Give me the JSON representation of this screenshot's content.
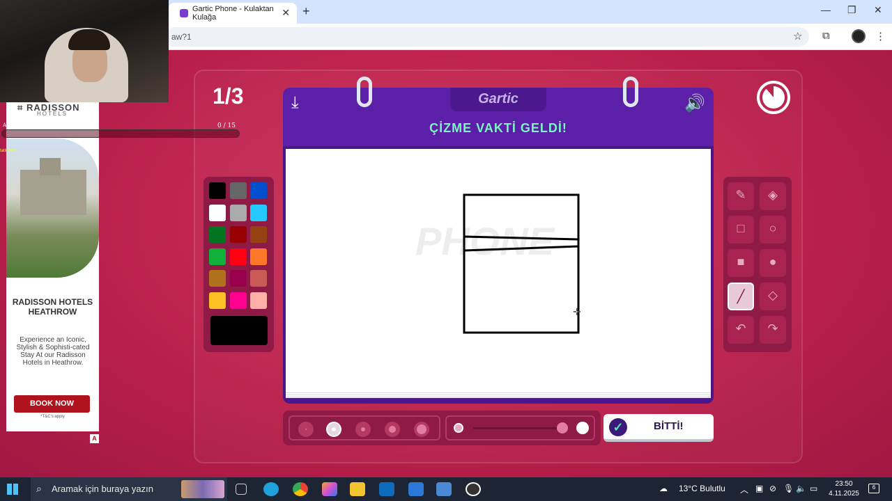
{
  "browser": {
    "tab_title": "Gartic Phone - Kulaktan Kulağa",
    "new_tab": "+",
    "close_tab": "✕",
    "url_fragment": "aw?1",
    "window_controls": [
      "—",
      "❐",
      "✕"
    ],
    "icons": [
      "star-icon",
      "extensions-icon",
      "profile-icon",
      "menu-icon"
    ]
  },
  "game": {
    "round": "1/3",
    "progress": "0 / 15",
    "logo": "Gartic",
    "instruction": "ÇİZME VAKTİ GELDİ!",
    "watermark": "PHONE",
    "done_label": "BİTTİ!",
    "palette": [
      "#000000",
      "#666666",
      "#0050cd",
      "#ffffff",
      "#aaaaaa",
      "#26c9ff",
      "#017420",
      "#990000",
      "#964112",
      "#11b03c",
      "#ff0013",
      "#ff7829",
      "#b0701c",
      "#99004e",
      "#cb5a57",
      "#ffc126",
      "#ff008f",
      "#feafa8"
    ],
    "selected_color": "#000000",
    "tools": [
      "pencil-icon",
      "eraser-icon",
      "rectangle-outline-icon",
      "ellipse-outline-icon",
      "rectangle-filled-icon",
      "ellipse-filled-icon",
      "line-icon",
      "fill-bucket-icon",
      "undo-icon",
      "redo-icon"
    ],
    "active_tool": "line-icon",
    "brush_sizes": 5,
    "selected_size_index": 1,
    "opacity_level": 0.9
  },
  "overlay": {
    "bar_text": "AYLIK ABONE HEDEFİ",
    "chat_user": "tatlıcadır"
  },
  "ad": {
    "brand": "RADISSON",
    "brand_sub": "HOTELS",
    "title": "RADISSON HOTELS HEATHROW",
    "text": "Experience an Iconic, Stylish & Sophisti-cated Stay At our Radisson Hotels in Heathrow.",
    "cta": "BOOK NOW",
    "terms": "*T&C's apply",
    "adchoices": "A"
  },
  "taskbar": {
    "search_placeholder": "Aramak için buraya yazın",
    "weather": "13°C  Bulutlu",
    "time": "23:50",
    "date": "4.11.2025",
    "notifications": "6"
  }
}
